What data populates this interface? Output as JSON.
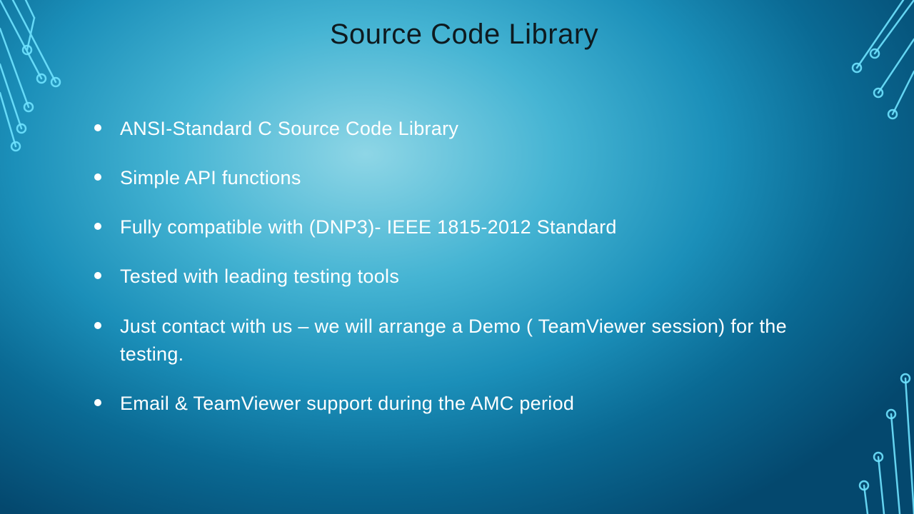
{
  "slide": {
    "title": "Source Code Library",
    "bullets": [
      "ANSI-Standard C Source Code Library",
      "Simple API functions",
      "Fully compatible with (DNP3)- IEEE 1815-2012 Standard",
      "Tested with leading testing tools",
      "Just contact with us – we will arrange a Demo ( TeamViewer session) for the testing.",
      "Email & TeamViewer support during the AMC period"
    ]
  }
}
